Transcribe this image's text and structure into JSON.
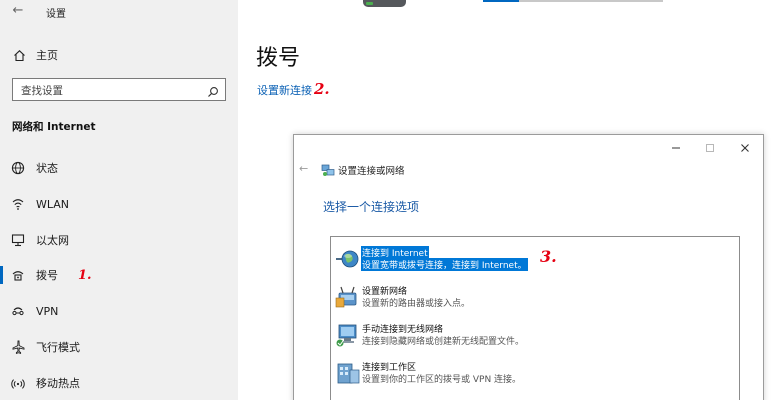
{
  "window": {
    "title": "设置",
    "back_glyph": "←"
  },
  "sidebar": {
    "home_label": "主页",
    "search": {
      "placeholder": "查找设置"
    },
    "section_title": "网络和 Internet",
    "items": [
      {
        "label": "状态",
        "icon": "status-globe-icon"
      },
      {
        "label": "WLAN",
        "icon": "wifi-icon"
      },
      {
        "label": "以太网",
        "icon": "ethernet-icon"
      },
      {
        "label": "拨号",
        "icon": "dialup-icon",
        "active": true
      },
      {
        "label": "VPN",
        "icon": "vpn-icon"
      },
      {
        "label": "飞行模式",
        "icon": "airplane-icon"
      },
      {
        "label": "移动热点",
        "icon": "hotspot-icon"
      }
    ],
    "annotation": "1."
  },
  "main": {
    "title": "拨号",
    "link_new_connection": "设置新连接",
    "annotation": "2."
  },
  "dialog": {
    "title": "设置连接或网络",
    "heading": "选择一个连接选项",
    "options": [
      {
        "title": "连接到 Internet",
        "desc": "设置宽带或拨号连接，连接到 Internet。",
        "icon": "globe-connect-icon",
        "selected": true
      },
      {
        "title": "设置新网络",
        "desc": "设置新的路由器或接入点。",
        "icon": "new-network-icon",
        "selected": false
      },
      {
        "title": "手动连接到无线网络",
        "desc": "连接到隐藏网络或创建新无线配置文件。",
        "icon": "wireless-manual-icon",
        "selected": false
      },
      {
        "title": "连接到工作区",
        "desc": "设置到你的工作区的拨号或 VPN 连接。",
        "icon": "workplace-icon",
        "selected": false
      }
    ],
    "annotation": "3."
  },
  "colors": {
    "accent": "#0067c0",
    "selection": "#0078d7",
    "annotation_red": "#e60012",
    "sidebar_bg": "#f0f0f0"
  }
}
